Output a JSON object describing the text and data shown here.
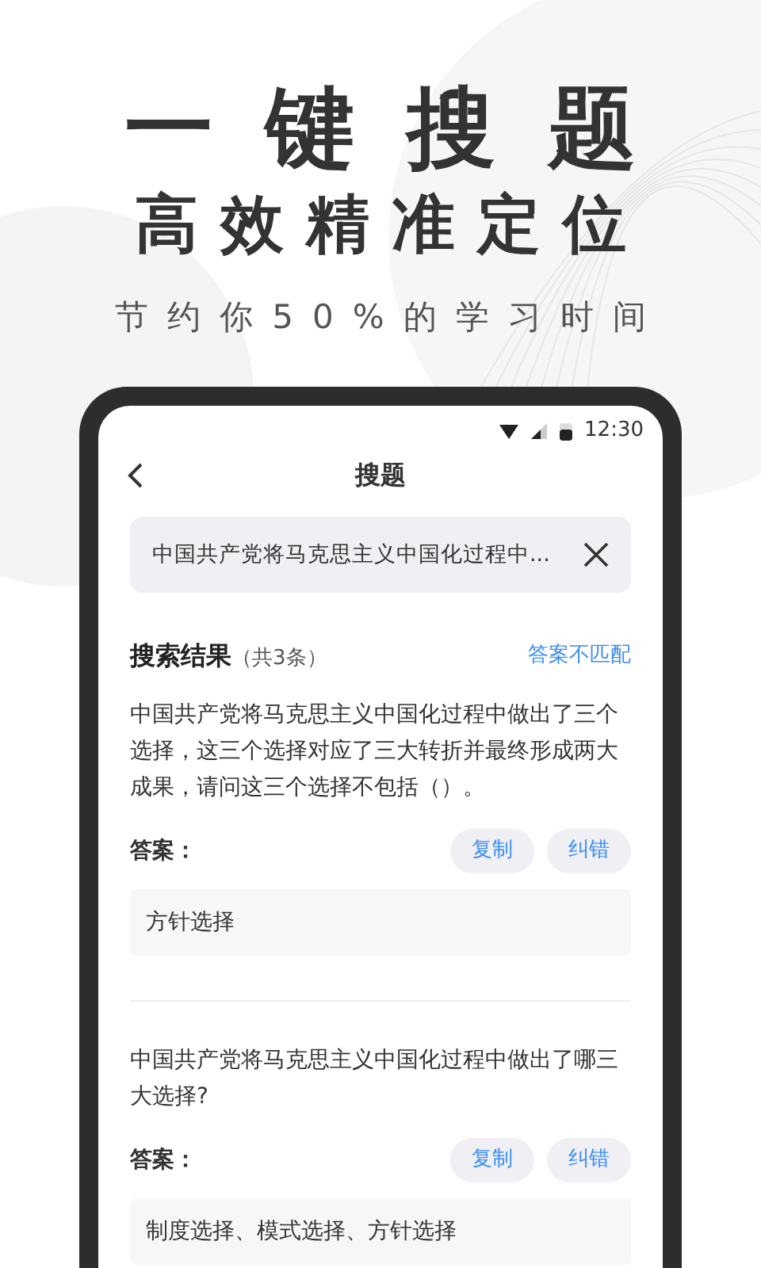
{
  "headline": "一键搜题",
  "subheadline": "高效精准定位",
  "tagline": "节约你50%的学习时间",
  "status_bar": {
    "time": "12:30"
  },
  "nav": {
    "title": "搜题"
  },
  "search": {
    "value": "中国共产党将马克思主义中国化过程中..."
  },
  "results": {
    "title": "搜索结果",
    "count": "（共3条）",
    "mismatch_link": "答案不匹配",
    "items": [
      {
        "question": "中国共产党将马克思主义中国化过程中做出了三个选择，这三个选择对应了三大转折并最终形成两大成果，请问这三个选择不包括（）。",
        "answer_label": "答案：",
        "buttons": [
          "复制",
          "纠错"
        ],
        "answer": "方针选择"
      },
      {
        "question": "中国共产党将马克思主义中国化过程中做出了哪三大选择?",
        "answer_label": "答案：",
        "buttons": [
          "复制",
          "纠错"
        ],
        "answer": "制度选择、模式选择、方针选择"
      }
    ]
  }
}
